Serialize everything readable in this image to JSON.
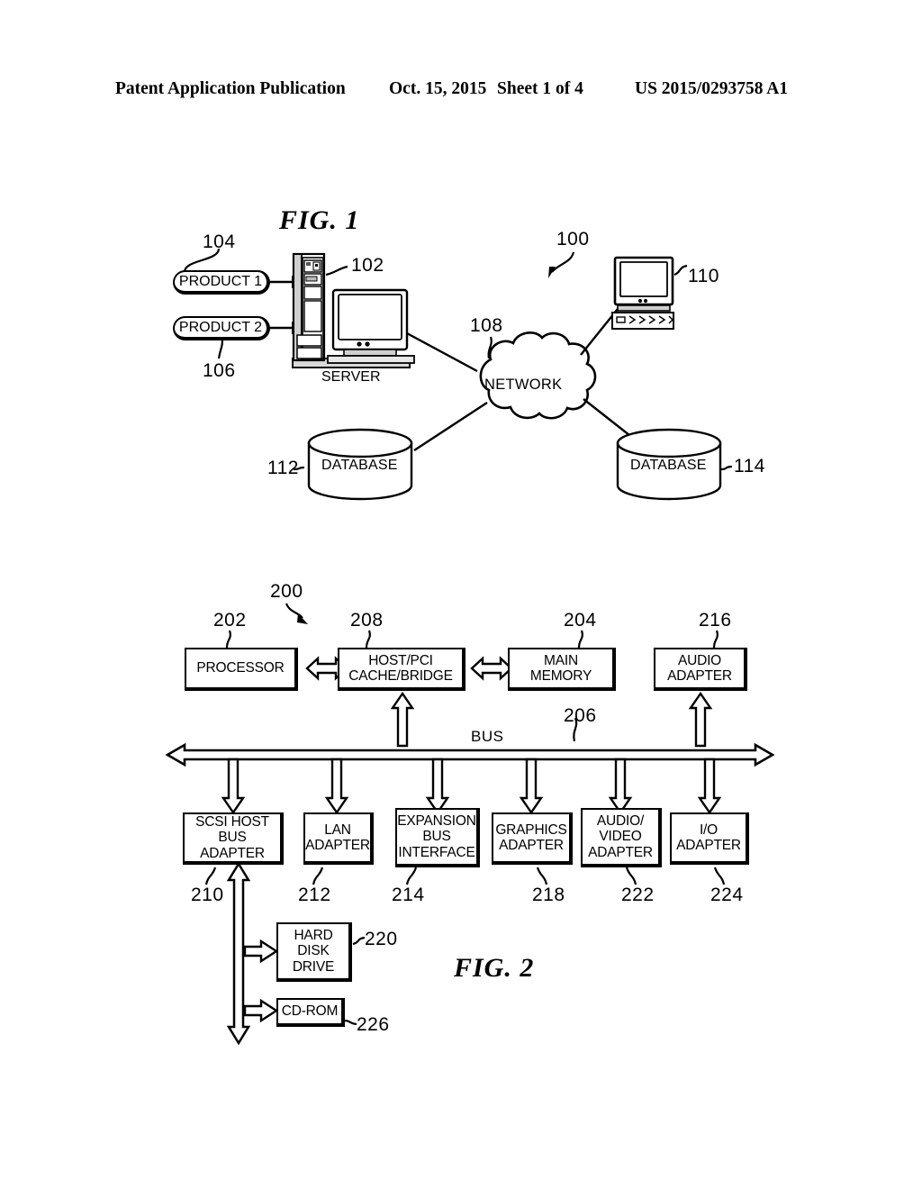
{
  "header": {
    "publication": "Patent Application Publication",
    "date": "Oct. 15, 2015",
    "sheet": "Sheet 1 of 4",
    "number": "US 2015/0293758 A1"
  },
  "fig1": {
    "title": "FIG. 1",
    "system_ref": "100",
    "server_ref": "102",
    "server_label": "SERVER",
    "network_label": "NETWORK",
    "network_ref": "108",
    "client_ref": "110",
    "products": [
      {
        "label": "PRODUCT 1",
        "ref": "104"
      },
      {
        "label": "PRODUCT 2",
        "ref": "106"
      }
    ],
    "databases": [
      {
        "label": "DATABASE",
        "ref": "112"
      },
      {
        "label": "DATABASE",
        "ref": "114"
      }
    ]
  },
  "fig2": {
    "title": "FIG. 2",
    "system_ref": "200",
    "bus_label": "BUS",
    "bus_ref": "206",
    "top_blocks": [
      {
        "label": "PROCESSOR",
        "ref": "202"
      },
      {
        "label": "HOST/PCI\nCACHE/BRIDGE",
        "ref": "208"
      },
      {
        "label": "MAIN\nMEMORY",
        "ref": "204"
      },
      {
        "label": "AUDIO\nADAPTER",
        "ref": "216"
      }
    ],
    "bottom_blocks": [
      {
        "label": "SCSI HOST\nBUS ADAPTER",
        "ref": "210"
      },
      {
        "label": "LAN\nADAPTER",
        "ref": "212"
      },
      {
        "label": "EXPANSION\nBUS\nINTERFACE",
        "ref": "214"
      },
      {
        "label": "GRAPHICS\nADAPTER",
        "ref": "218"
      },
      {
        "label": "AUDIO/\nVIDEO\nADAPTER",
        "ref": "222"
      },
      {
        "label": "I/O\nADAPTER",
        "ref": "224"
      }
    ],
    "storage_blocks": [
      {
        "label": "HARD\nDISK\nDRIVE",
        "ref": "220"
      },
      {
        "label": "CD-ROM",
        "ref": "226"
      }
    ]
  },
  "colors": {
    "ink": "#000000",
    "paper": "#ffffff",
    "shade": "#cfcfcf"
  }
}
